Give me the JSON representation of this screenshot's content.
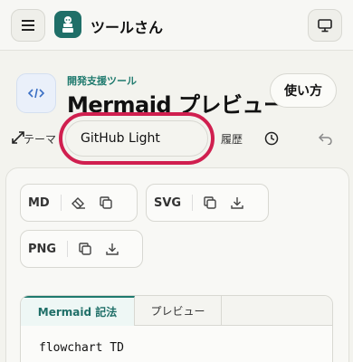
{
  "app": {
    "title": "ツールさん"
  },
  "header": {
    "category": "開発支援ツール",
    "title": "Mermaid プレビュー",
    "usage_button": "使い方"
  },
  "controls": {
    "theme_label": "テーマ",
    "theme_value": "GitHub Light",
    "history_label": "履歴"
  },
  "export_groups": {
    "md": "MD",
    "svg": "SVG",
    "png": "PNG"
  },
  "editor": {
    "tab_mermaid": "Mermaid 記法",
    "tab_preview": "プレビュー",
    "code_line": "flowchart TD"
  },
  "colors": {
    "accent": "#1f7a6e",
    "highlight": "#d01f4f"
  },
  "icons": [
    "menu-icon",
    "app-logo-icon",
    "monitor-icon",
    "code-icon",
    "expand-icon",
    "clock-icon",
    "undo-icon",
    "eraser-icon",
    "copy-icon",
    "download-icon"
  ]
}
